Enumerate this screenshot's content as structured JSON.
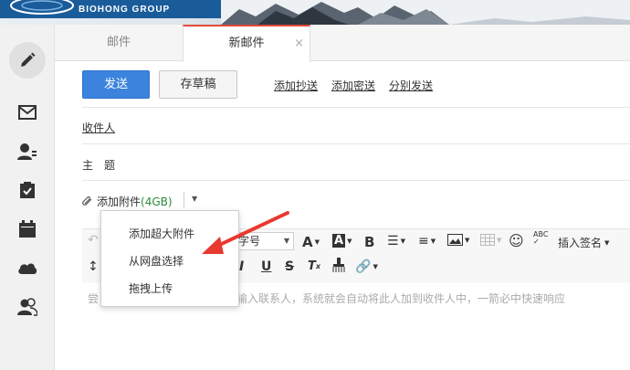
{
  "banner": {
    "logo_text": "BIOHONG GROUP",
    "logo_color": "#1a5c9a"
  },
  "rail": {
    "icons": [
      "compose-icon",
      "mail-icon",
      "contacts-icon",
      "tasks-icon",
      "calendar-icon",
      "cloud-icon",
      "groups-icon"
    ]
  },
  "tabs": [
    {
      "label": "邮件"
    },
    {
      "label": "新邮件",
      "close": "×"
    }
  ],
  "toolbar": {
    "send_label": "发送",
    "draft_label": "存草稿",
    "add_cc": "添加抄送",
    "add_bcc": "添加密送",
    "separate_send": "分别发送"
  },
  "fields": {
    "recipient_label": "收件人",
    "subject_label": "主　题"
  },
  "attachment": {
    "label": "添加附件",
    "size": "(4GB)"
  },
  "editor": {
    "font_size_label": "字号",
    "insert_signature": "插入签名",
    "body_hint_left": "尝",
    "body_hint_right": "输入联系人，系统就会自动将此人加到收件人中，一箭必中快速响应"
  },
  "menu": {
    "items": [
      "添加超大附件",
      "从网盘选择",
      "拖拽上传"
    ]
  },
  "colors": {
    "accent_blue": "#3b83dd",
    "tab_accent_red": "#e04a3a",
    "annotation_arrow": "#e8392f",
    "attach_size_green": "#2a8a3a"
  }
}
